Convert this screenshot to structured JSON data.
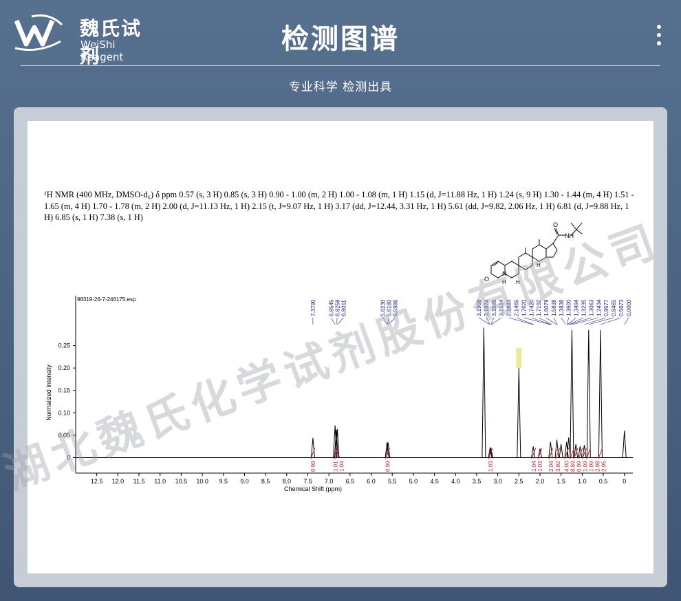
{
  "header": {
    "logo_cn": "魏氏试剂",
    "logo_en": "WeiShi Reagent",
    "title": "检测图谱",
    "subtitle": "专业科学  检测出具",
    "menu_icon": "more-vertical-icon"
  },
  "report": {
    "nmr_text": "¹H NMR (400 MHz, DMSO-d₆) δ ppm 0.57 (s, 3 H) 0.85 (s, 3 H) 0.90 - 1.00 (m, 2 H) 1.00 - 1.08 (m, 1 H) 1.15 (d,  J=11.88 Hz, 1 H) 1.24 (s, 9 H) 1.30 - 1.44 (m, 4 H) 1.51 - 1.65 (m, 4 H) 1.70 - 1.78 (m, 2 H) 2.00 (d,  J=11.13 Hz, 1 H) 2.15 (t,  J=9.07 Hz, 1 H) 3.17 (dd,  J=12.44, 3.31 Hz, 1 H) 5.61 (dd,  J=9.82, 2.06 Hz, 1 H) 6.81 (d,  J=9.88 Hz, 1 H) 6.85 (s, 1 H) 7.38 (s, 1 H)",
    "structure_labels": {
      "nh_right": "NH",
      "o_left": "O",
      "n_left": "N",
      "h_left": "H",
      "h_right": "H",
      "h_mid": "H"
    },
    "watermark": "湖北魏氏化学试剂股份有限公司"
  },
  "chart_data": {
    "type": "line",
    "file_label": "98319-26-7-246175.esp",
    "xlabel": "Chemical Shift (ppm)",
    "ylabel": "Normalized Intensity",
    "x_reversed": true,
    "xlim": [
      13.0,
      -0.2
    ],
    "ylim": [
      -0.01,
      0.3
    ],
    "xticks": [
      "12.5",
      "12.0",
      "11.5",
      "11.0",
      "10.5",
      "10.0",
      "9.5",
      "9.0",
      "8.5",
      "8.0",
      "7.5",
      "7.0",
      "6.5",
      "6.0",
      "5.5",
      "5.0",
      "4.5",
      "4.0",
      "3.5",
      "3.0",
      "2.5",
      "2.0",
      "1.5",
      "1.0",
      "0.5",
      "0"
    ],
    "yticks": [
      "0.25",
      "0.20",
      "0.15",
      "0.10",
      "0.05",
      "0"
    ],
    "peak_labels": [
      "7.3790",
      "6.8545",
      "6.8258",
      "6.8011",
      "5.6230",
      "5.6180",
      "5.5986",
      "3.1908",
      "3.1824",
      "3.1595",
      "3.1514",
      "2.1693",
      "2.1465",
      "1.7620",
      "1.7420",
      "1.7192",
      "1.6079",
      "1.5838",
      "1.3838",
      "1.3600",
      "1.3494",
      "1.3235",
      "1.3063",
      "1.2434",
      "0.9577",
      "0.8465",
      "0.5673",
      "0.0000"
    ],
    "peaks": [
      {
        "x": 7.379,
        "y": 0.044
      },
      {
        "x": 6.8545,
        "y": 0.072
      },
      {
        "x": 6.8258,
        "y": 0.062
      },
      {
        "x": 6.8011,
        "y": 0.064
      },
      {
        "x": 5.623,
        "y": 0.034
      },
      {
        "x": 5.5986,
        "y": 0.034
      },
      {
        "x": 3.33,
        "y": 0.29
      },
      {
        "x": 3.18,
        "y": 0.023
      },
      {
        "x": 3.16,
        "y": 0.021
      },
      {
        "x": 2.5,
        "y": 0.2
      },
      {
        "x": 2.16,
        "y": 0.025
      },
      {
        "x": 2.0,
        "y": 0.02
      },
      {
        "x": 1.75,
        "y": 0.035
      },
      {
        "x": 1.6,
        "y": 0.04
      },
      {
        "x": 1.5,
        "y": 0.03
      },
      {
        "x": 1.37,
        "y": 0.035
      },
      {
        "x": 1.32,
        "y": 0.045
      },
      {
        "x": 1.2434,
        "y": 0.285
      },
      {
        "x": 1.15,
        "y": 0.03
      },
      {
        "x": 1.05,
        "y": 0.025
      },
      {
        "x": 0.95,
        "y": 0.028
      },
      {
        "x": 0.8465,
        "y": 0.285
      },
      {
        "x": 0.5673,
        "y": 0.285
      },
      {
        "x": 0.0,
        "y": 0.06
      }
    ],
    "integrals": [
      {
        "x": 7.38,
        "label": "0.99"
      },
      {
        "x": 6.85,
        "label": "1.01"
      },
      {
        "x": 6.81,
        "label": "1.04"
      },
      {
        "x": 5.61,
        "label": "0.99"
      },
      {
        "x": 3.17,
        "label": "1.03"
      },
      {
        "x": 2.15,
        "label": "1.04"
      },
      {
        "x": 2.0,
        "label": "1.03"
      },
      {
        "x": 1.74,
        "label": "2.04"
      },
      {
        "x": 1.58,
        "label": "3.92"
      },
      {
        "x": 1.37,
        "label": "4.00"
      },
      {
        "x": 1.24,
        "label": "8.89"
      },
      {
        "x": 1.15,
        "label": "0.99"
      },
      {
        "x": 1.04,
        "label": "1.09"
      },
      {
        "x": 0.95,
        "label": "1.99"
      },
      {
        "x": 0.85,
        "label": "2.98"
      },
      {
        "x": 0.57,
        "label": "2.95"
      }
    ],
    "colors": {
      "spectrum": "#000000",
      "peak_labels": "#1a1a8c",
      "integrals": "#cc2233",
      "solvent_band": "#e8ec9c"
    }
  }
}
